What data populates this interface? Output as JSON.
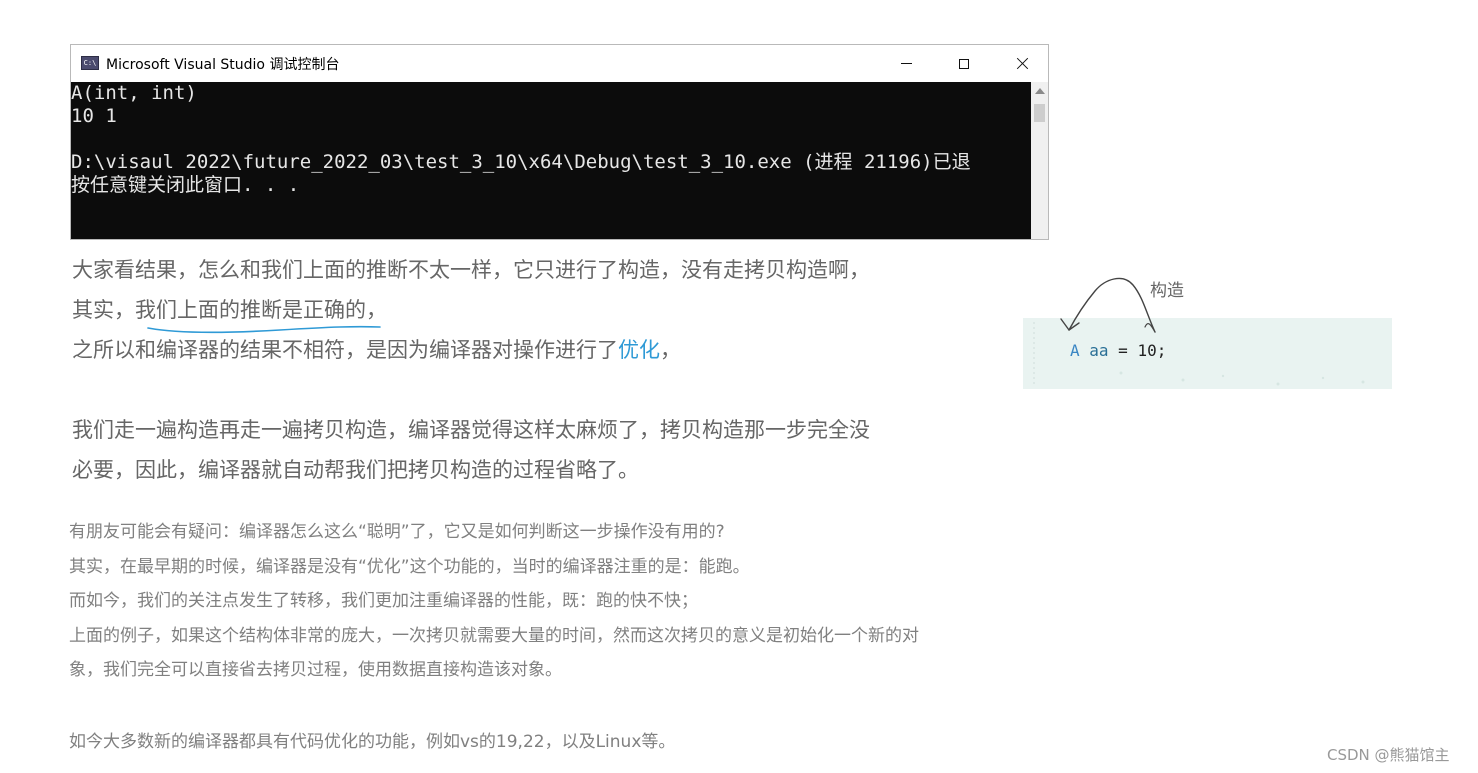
{
  "console_window": {
    "icon_label": "C:\\",
    "title": "Microsoft Visual Studio 调试控制台",
    "output_lines": [
      "A(int, int)",
      "10 1",
      "",
      "D:\\visaul 2022\\future_2022_03\\test_3_10\\x64\\Debug\\test_3_10.exe (进程 21196)已退",
      "按任意键关闭此窗口. . ."
    ]
  },
  "article": {
    "para1": {
      "line1": "大家看结果，怎么和我们上面的推断不太一样，它只进行了构造，没有走拷贝构造啊，",
      "line2": "其实，我们上面的推断是正确的，",
      "line3_before": "之所以和编译器的结果不相符，是因为编译器对操作进行了",
      "line3_highlight": "优化",
      "line3_after": "，"
    },
    "para2": {
      "line1": "我们走一遍构造再走一遍拷贝构造，编译器觉得这样太麻烦了，拷贝构造那一步完全没",
      "line2": "必要，因此，编译器就自动帮我们把拷贝构造的过程省略了。"
    },
    "para3": [
      "有朋友可能会有疑问：编译器怎么这么“聪明”了，它又是如何判断这一步操作没有用的?",
      "其实，在最早期的时候，编译器是没有“优化”这个功能的，当时的编译器注重的是：能跑。",
      "而如今，我们的关注点发生了转移，我们更加注重编译器的性能，既：跑的快不快；",
      "上面的例子，如果这个结构体非常的庞大，一次拷贝就需要大量的时间，然而这次拷贝的意义是初始化一个新的对",
      "象，我们完全可以直接省去拷贝过程，使用数据直接构造该对象。"
    ],
    "para4": "如今大多数新的编译器都具有代码优化的功能，例如vs的19,22，以及Linux等。"
  },
  "code_snippet": {
    "type_token": "A",
    "ident_token": "aa",
    "rest": " = 10;"
  },
  "annotation": {
    "label": "构造"
  },
  "watermark": "CSDN @熊猫馆主",
  "colors": {
    "console_bg": "#0c0c0c",
    "console_text": "#e6e6e6",
    "highlight": "#2f9ad6",
    "code_panel_bg": "#e9f3f1",
    "underline_stroke": "#2f9ad6"
  }
}
